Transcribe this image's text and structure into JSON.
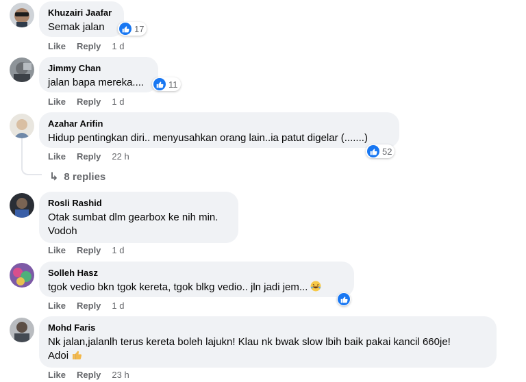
{
  "comments": [
    {
      "name": "Khuzairi Jaafar",
      "text": "Semak jalan",
      "reactions": "17",
      "like": "Like",
      "reply": "Reply",
      "time": "1 d"
    },
    {
      "name": "Jimmy Chan",
      "text": "jalan bapa mereka....",
      "reactions": "11",
      "like": "Like",
      "reply": "Reply",
      "time": "1 d"
    },
    {
      "name": "Azahar Arifin",
      "text": "Hidup pentingkan diri.. menyusahkan orang lain..ia patut digelar (.......)",
      "reactions": "52",
      "like": "Like",
      "reply": "Reply",
      "time": "22 h",
      "replies_label": "8 replies"
    },
    {
      "name": "Rosli Rashid",
      "text_line1": "Otak sumbat dlm gearbox ke nih min.",
      "text_line2": "Vodoh",
      "like": "Like",
      "reply": "Reply",
      "time": "1 d"
    },
    {
      "name": "Solleh Hasz",
      "text": "tgok vedio bkn tgok kereta, tgok blkg vedio.. jln jadi jem...",
      "like": "Like",
      "reply": "Reply",
      "time": "1 d"
    },
    {
      "name": "Mohd Faris",
      "text_line1": "Nk jalan,jalanlh terus kereta boleh lajukn! Klau nk bwak slow lbih baik pakai kancil 660je!",
      "text_line2": "Adoi",
      "like": "Like",
      "reply": "Reply",
      "time": "23 h"
    }
  ],
  "colors": {
    "bubble": "#f0f2f5",
    "like_blue": "#1877f2",
    "meta": "#65676b"
  }
}
